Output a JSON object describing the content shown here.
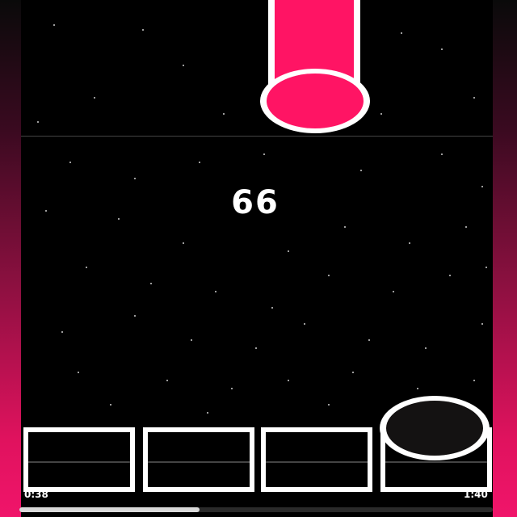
{
  "game": {
    "score": "66",
    "accent_color": "#ff1464",
    "lanes": [
      {
        "name": "lane-1",
        "pressed": false
      },
      {
        "name": "lane-2",
        "pressed": false
      },
      {
        "name": "lane-3",
        "pressed": false
      },
      {
        "name": "lane-4",
        "pressed": true
      }
    ]
  },
  "playback": {
    "elapsed": "0:38",
    "total": "1:40",
    "progress_fraction": 0.38
  }
}
